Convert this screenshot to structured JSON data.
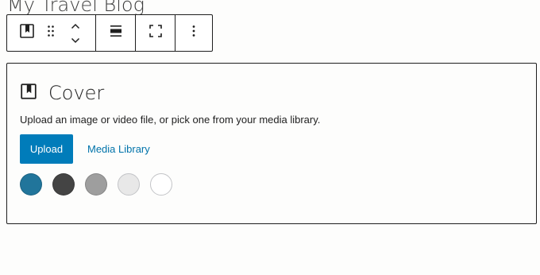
{
  "post_title": "My Travel Blog",
  "toolbar": {
    "block_icon": "cover-block-icon",
    "drag_icon": "drag-handle-icon",
    "move_up_icon": "chevron-up-icon",
    "move_down_icon": "chevron-down-icon",
    "align_icon": "align-wide-icon",
    "fullheight_icon": "full-height-icon",
    "more_icon": "more-options-icon"
  },
  "cover": {
    "icon": "cover-block-icon",
    "title": "Cover",
    "instructions": "Upload an image or video file, or pick one from your media library.",
    "upload_label": "Upload",
    "media_library_label": "Media Library",
    "swatches": [
      {
        "color": "#21759b"
      },
      {
        "color": "#444444"
      },
      {
        "color": "#9e9e9e"
      },
      {
        "color": "#e8e8e8"
      },
      {
        "color": "#ffffff"
      }
    ]
  },
  "colors": {
    "accent": "#007cba",
    "link": "#0073aa",
    "border": "#1e1e1e"
  }
}
